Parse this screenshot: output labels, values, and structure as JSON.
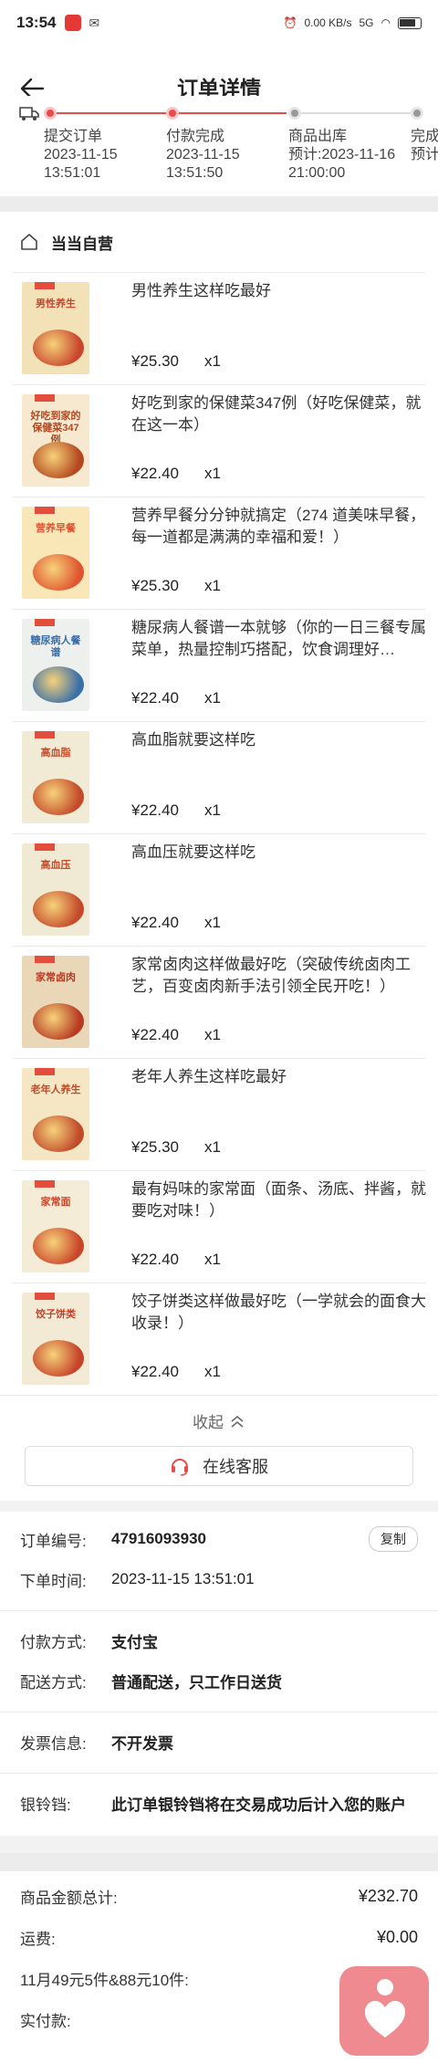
{
  "status_bar": {
    "time": "13:54",
    "net_speed": "0.00 KB/s",
    "network": "5G"
  },
  "header": {
    "title": "订单详情"
  },
  "progress": {
    "steps": [
      {
        "label": "提交订单",
        "date": "2023-11-15",
        "time": "13:51:01"
      },
      {
        "label": "付款完成",
        "date": "2023-11-15",
        "time": "13:51:50"
      },
      {
        "label": "商品出库",
        "date": "预计:2023-11-16",
        "time": "21:00:00"
      },
      {
        "label": "完成",
        "date": "预计",
        "time": ""
      }
    ],
    "active_color": "#e94b4b"
  },
  "shop": {
    "name": "当当自营"
  },
  "items": [
    {
      "title": "男性养生这样吃最好",
      "price": "¥25.30",
      "qty": "x1",
      "cover_text": "男性养生",
      "cover_bg": "#f3e2b8",
      "cover_color": "#c8462d"
    },
    {
      "title": "好吃到家的保健菜347例（好吃保健菜，就在这一本）",
      "price": "¥22.40",
      "qty": "x1",
      "cover_text": "好吃到家的保健菜347例",
      "cover_bg": "#f6e9d0",
      "cover_color": "#b4471f"
    },
    {
      "title": "营养早餐分分钟就搞定（274 道美味早餐，每一道都是满满的幸福和爱！）",
      "price": "¥25.30",
      "qty": "x1",
      "cover_text": "营养早餐",
      "cover_bg": "#f9e7b8",
      "cover_color": "#e0552f"
    },
    {
      "title": "糖尿病人餐谱一本就够（你的一日三餐专属菜单，热量控制巧搭配，饮食调理好…",
      "price": "¥22.40",
      "qty": "x1",
      "cover_text": "糖尿病人餐谱",
      "cover_bg": "#eef0ee",
      "cover_color": "#3a6fa8"
    },
    {
      "title": "高血脂就要这样吃",
      "price": "¥22.40",
      "qty": "x1",
      "cover_text": "高血脂",
      "cover_bg": "#f1ebd6",
      "cover_color": "#c44a2a"
    },
    {
      "title": "高血压就要这样吃",
      "price": "¥22.40",
      "qty": "x1",
      "cover_text": "高血压",
      "cover_bg": "#f0e9d4",
      "cover_color": "#c44a2a"
    },
    {
      "title": "家常卤肉这样做最好吃（突破传统卤肉工艺，百变卤肉新手法引领全民开吃！）",
      "price": "¥22.40",
      "qty": "x1",
      "cover_text": "家常卤肉",
      "cover_bg": "#ead7b8",
      "cover_color": "#b63b22"
    },
    {
      "title": "老年人养生这样吃最好",
      "price": "¥25.30",
      "qty": "x1",
      "cover_text": "老年人养生",
      "cover_bg": "#f5e6c4",
      "cover_color": "#c14a2b"
    },
    {
      "title": "最有妈味的家常面（面条、汤底、拌酱，就要吃对味！）",
      "price": "¥22.40",
      "qty": "x1",
      "cover_text": "家常面",
      "cover_bg": "#f4ecd7",
      "cover_color": "#c9452a"
    },
    {
      "title": "饺子饼类这样做最好吃（一学就会的面食大收录！）",
      "price": "¥22.40",
      "qty": "x1",
      "cover_text": "饺子饼类",
      "cover_bg": "#f3ead6",
      "cover_color": "#c5432a"
    }
  ],
  "collapse_label": "收起",
  "service_label": "在线客服",
  "order_info": {
    "order_no_label": "订单编号:",
    "order_no": "47916093930",
    "copy_label": "复制",
    "order_time_label": "下单时间:",
    "order_time": "2023-11-15 13:51:01",
    "pay_label": "付款方式:",
    "pay_value": "支付宝",
    "ship_label": "配送方式:",
    "ship_value": "普通配送，只工作日送货",
    "invoice_label": "发票信息:",
    "invoice_value": "不开发票",
    "silver_label": "银铃铛:",
    "silver_value": "此订单银铃铛将在交易成功后计入您的账户"
  },
  "totals": {
    "goods_label": "商品金额总计:",
    "goods_value": "¥232.70",
    "freight_label": "运费:",
    "freight_value": "¥0.00",
    "promo_label": "11月49元5件&88元10件:",
    "paid_label": "实付款:"
  }
}
